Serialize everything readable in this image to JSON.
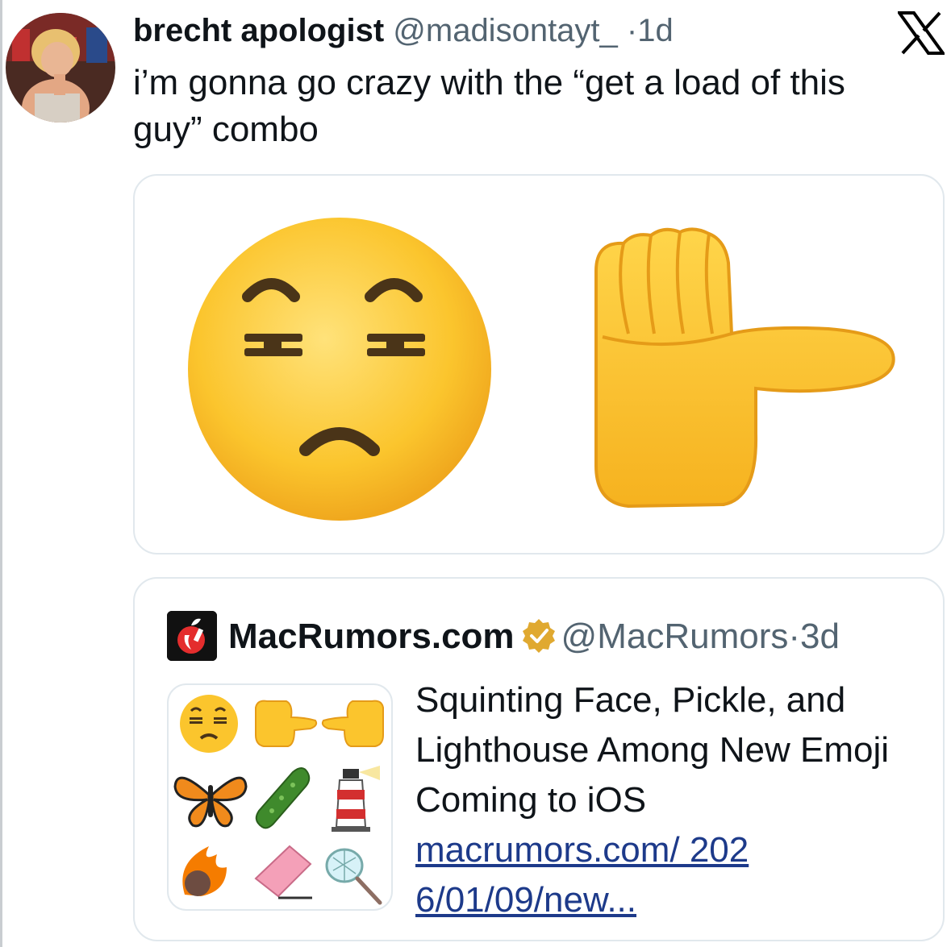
{
  "tweet": {
    "display_name": "brecht apologist",
    "handle": "@madisontayt_",
    "separator": "·",
    "time": "1d",
    "text": "i’m gonna go crazy with the “get a load of this guy” combo",
    "platform_icon": "x-logo-icon",
    "avatar_icon": "user-avatar-photo"
  },
  "media": {
    "emojis": [
      "squinting-face-emoji",
      "thumb-pointing-right-emoji"
    ]
  },
  "quote": {
    "display_name": "MacRumors.com",
    "handle": "@MacRumors",
    "separator": "·",
    "time": "3d",
    "verified_icon": "verified-badge-icon",
    "logo_icon": "macrumors-logo-icon",
    "link_title": "Squinting Face, Pickle, and Lighthouse Among New Emoji Coming to iOS",
    "link_url": "macrumors.com/ 2026/01/09/new...",
    "thumbnail_icons": [
      "squinting-face",
      "thumb-right",
      "thumb-left",
      "butterfly",
      "pickle",
      "lighthouse",
      "meteor",
      "eraser",
      "net"
    ]
  },
  "colors": {
    "text": "#0f1419",
    "secondary": "#536471",
    "link": "#1d3a8a",
    "emoji_yellow": "#fbc52d",
    "verified_gold": "#e0a930"
  }
}
